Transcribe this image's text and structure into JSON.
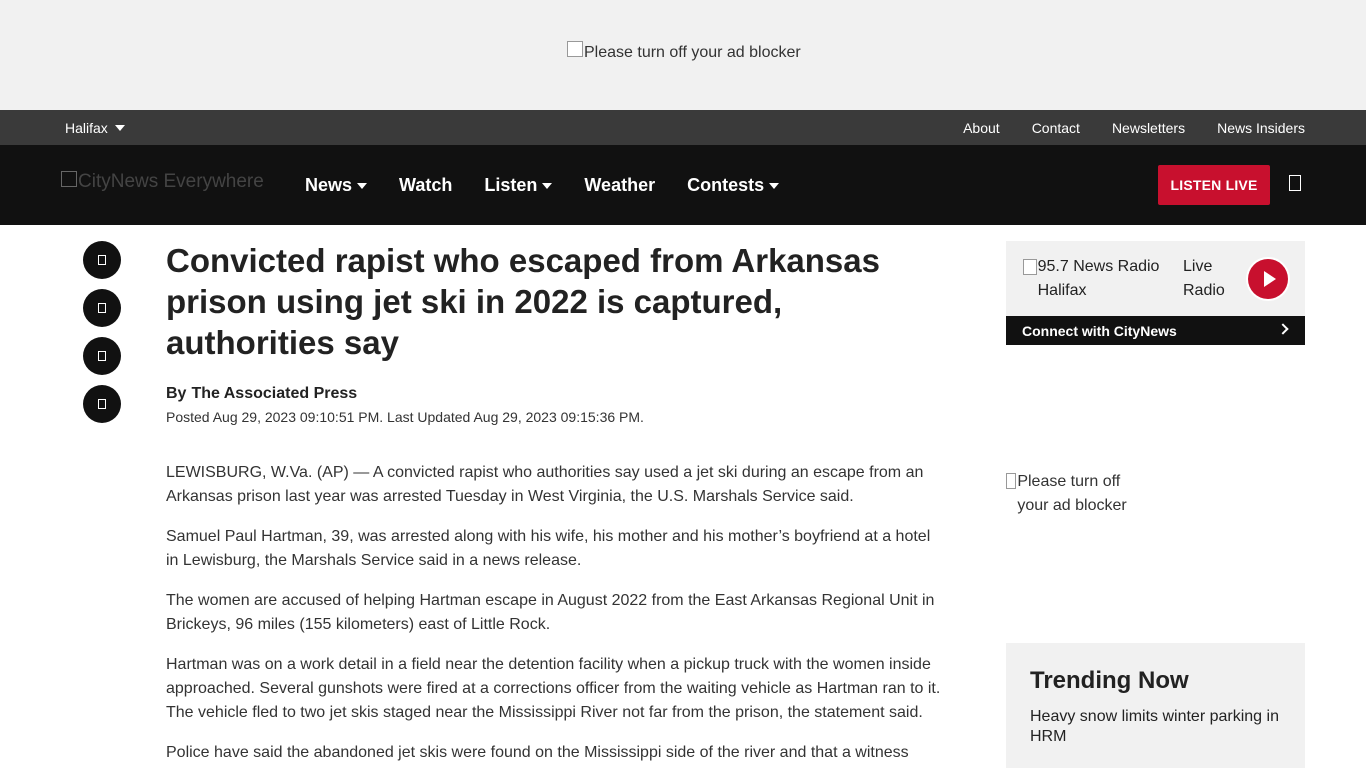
{
  "ad_top": {
    "alt_text": "Please turn off your ad blocker"
  },
  "utility_bar": {
    "region": "Halifax",
    "links": [
      "About",
      "Contact",
      "Newsletters",
      "News Insiders"
    ]
  },
  "main_nav": {
    "logo_alt": "CityNews Everywhere",
    "items": [
      {
        "label": "News",
        "dropdown": true
      },
      {
        "label": "Watch",
        "dropdown": false
      },
      {
        "label": "Listen",
        "dropdown": true
      },
      {
        "label": "Weather",
        "dropdown": false
      },
      {
        "label": "Contests",
        "dropdown": true
      }
    ],
    "listen_live": "LISTEN LIVE"
  },
  "article": {
    "headline": "Convicted rapist who escaped from Arkansas prison using jet ski in 2022 is captured, authorities say",
    "by": "By",
    "author": "The Associated Press",
    "dates": "Posted Aug 29, 2023 09:10:51 PM.  Last Updated Aug 29, 2023 09:15:36 PM.",
    "paragraphs": [
      "LEWISBURG, W.Va. (AP) — A convicted rapist who authorities say used a jet ski during an escape from an Arkansas prison last year was arrested Tuesday in West Virginia, the U.S. Marshals Service said.",
      "Samuel Paul Hartman, 39, was arrested along with his wife, his mother and his mother’s boyfriend at a hotel in Lewisburg, the Marshals Service said in a news release.",
      "The women are accused of helping Hartman escape in August 2022 from the East Arkansas Regional Unit in Brickeys, 96 miles (155 kilometers) east of Little Rock.",
      "Hartman was on a work detail in a field near the detention facility when a pickup truck with the women inside approached. Several gunshots were fired at a corrections officer from the waiting vehicle as Hartman ran to it. The vehicle fled to two jet skis staged near the Mississippi River not far from the prison, the statement said.",
      "Police have said the abandoned jet skis were found on the Mississippi side of the river and that a witness"
    ]
  },
  "sidebar": {
    "station_alt": "95.7 News Radio Halifax",
    "live_radio": "Live Radio",
    "connect": "Connect with CityNews",
    "ad_alt": "Please turn off your ad blocker",
    "trending_title": "Trending Now",
    "trending_items": [
      "Heavy snow limits winter parking in HRM"
    ]
  },
  "colors": {
    "brand_red": "#c8102e",
    "nav_bg": "#111111",
    "util_bg": "#3a3a3a"
  }
}
